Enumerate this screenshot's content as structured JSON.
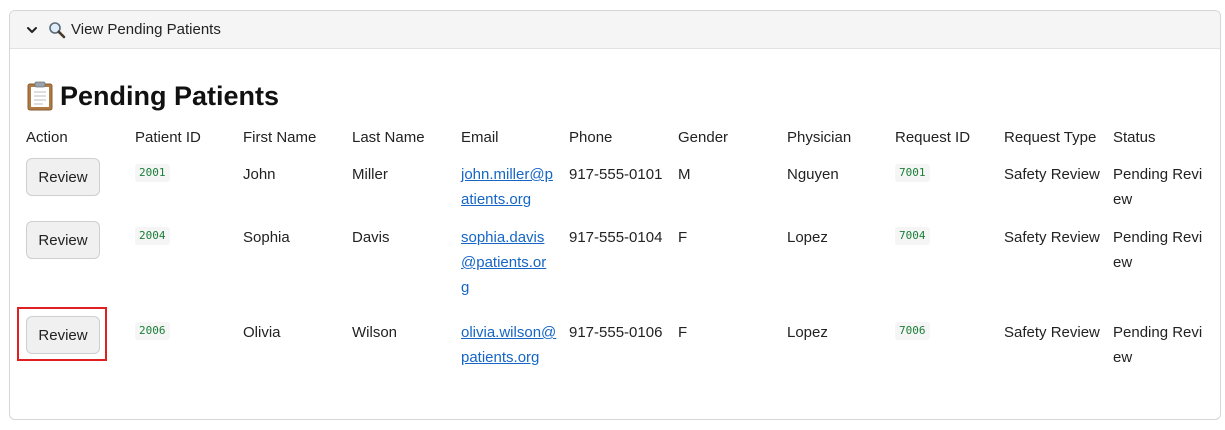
{
  "expander": {
    "label": "View Pending Patients",
    "expanded": true
  },
  "section": {
    "title": "Pending Patients",
    "icon": "clipboard-icon"
  },
  "table": {
    "columns": [
      "Action",
      "Patient ID",
      "First Name",
      "Last Name",
      "Email",
      "Phone",
      "Gender",
      "Physician",
      "Request ID",
      "Request Type",
      "Status"
    ],
    "rows": [
      {
        "action": "Review",
        "patient_id": "2001",
        "first_name": "John",
        "last_name": "Miller",
        "email": "john.miller@patients.org",
        "phone": "917-555-0101",
        "gender": "M",
        "physician": "Nguyen",
        "request_id": "7001",
        "request_type": "Safety Review",
        "status": "Pending Review"
      },
      {
        "action": "Review",
        "patient_id": "2004",
        "first_name": "Sophia",
        "last_name": "Davis",
        "email": "sophia.davis@patients.org",
        "phone": "917-555-0104",
        "gender": "F",
        "physician": "Lopez",
        "request_id": "7004",
        "request_type": "Safety Review",
        "status": "Pending Review"
      },
      {
        "action": "Review",
        "patient_id": "2006",
        "first_name": "Olivia",
        "last_name": "Wilson",
        "email": "olivia.wilson@patients.org",
        "phone": "917-555-0106",
        "gender": "F",
        "physician": "Lopez",
        "request_id": "7006",
        "request_type": "Safety Review",
        "status": "Pending Review"
      }
    ]
  },
  "colors": {
    "link": "#1666c5",
    "code_text": "#1a7f37",
    "highlight": "#e02020"
  }
}
